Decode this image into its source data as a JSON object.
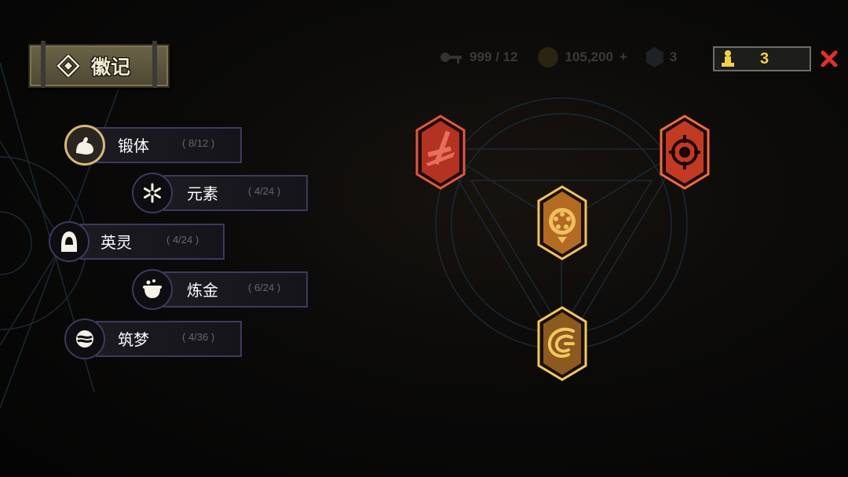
{
  "title": "徽记",
  "hud": {
    "keys": "999 / 12",
    "coins": "105,200",
    "coin_add": "+",
    "gem_count": "3",
    "resource_count": "3"
  },
  "categories": [
    {
      "name": "锻体",
      "count": "( 8/12 )",
      "icon": "flexed-arm-icon",
      "active": true
    },
    {
      "name": "元素",
      "count": "( 4/24 )",
      "icon": "snowflake-icon",
      "active": false
    },
    {
      "name": "英灵",
      "count": "( 4/24 )",
      "icon": "hooded-figure-icon",
      "active": false
    },
    {
      "name": "炼金",
      "count": "( 6/24 )",
      "icon": "cauldron-icon",
      "active": false
    },
    {
      "name": "筑梦",
      "count": "( 4/36 )",
      "icon": "dream-orb-icon",
      "active": false
    }
  ],
  "badges": [
    {
      "icon": "sword-slash-icon",
      "color": "#b33222",
      "border": "#e1583e"
    },
    {
      "icon": "target-burst-icon",
      "color": "#c23a22",
      "border": "#f06a43"
    },
    {
      "icon": "spinning-wheel-icon",
      "color": "#b36a22",
      "border": "#f0c060"
    },
    {
      "icon": "beast-claw-icon",
      "color": "#8c5a1f",
      "border": "#f2c860"
    }
  ],
  "colors": {
    "accent": "#d8b878",
    "panel_border": "#3d3a5e",
    "resource_text": "#f2d14a",
    "close": "#e0302b"
  }
}
